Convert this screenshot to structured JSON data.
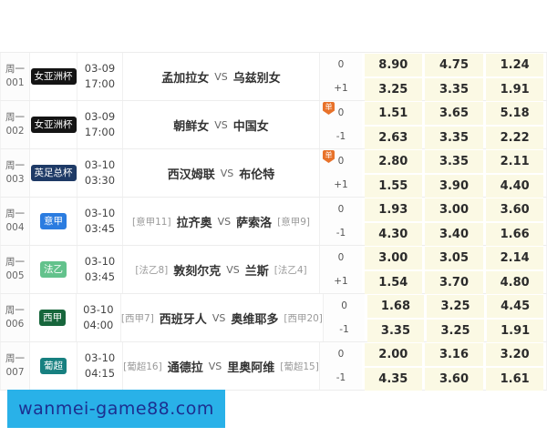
{
  "watermark": {
    "text": "wanmei-game88.com",
    "bg": "#29b1e8",
    "fg": "#1c2f90"
  },
  "icon": {
    "dan_label": "单",
    "color": "#e8722a"
  },
  "vs_label": "VS",
  "table": {
    "rows": [
      {
        "day": "周一",
        "num": "001",
        "league": "女亚洲杯",
        "league_color": "#141414",
        "date": "03-09",
        "time": "17:00",
        "home_tag": "",
        "home": "孟加拉女",
        "away": "乌兹别女",
        "away_tag": "",
        "has_icon": false,
        "lines": [
          {
            "handicap": "0",
            "odds": [
              "8.90",
              "4.75",
              "1.24"
            ]
          },
          {
            "handicap": "+1",
            "odds": [
              "3.25",
              "3.35",
              "1.91"
            ]
          }
        ]
      },
      {
        "day": "周一",
        "num": "002",
        "league": "女亚洲杯",
        "league_color": "#141414",
        "date": "03-09",
        "time": "17:00",
        "home_tag": "",
        "home": "朝鲜女",
        "away": "中国女",
        "away_tag": "",
        "has_icon": true,
        "lines": [
          {
            "handicap": "0",
            "odds": [
              "1.51",
              "3.65",
              "5.18"
            ]
          },
          {
            "handicap": "-1",
            "odds": [
              "2.63",
              "3.35",
              "2.22"
            ]
          }
        ]
      },
      {
        "day": "周一",
        "num": "003",
        "league": "英足总杯",
        "league_color": "#1e3a66",
        "date": "03-10",
        "time": "03:30",
        "home_tag": "",
        "home": "西汉姆联",
        "away": "布伦特",
        "away_tag": "",
        "has_icon": true,
        "lines": [
          {
            "handicap": "0",
            "odds": [
              "2.80",
              "3.35",
              "2.11"
            ]
          },
          {
            "handicap": "+1",
            "odds": [
              "1.55",
              "3.90",
              "4.40"
            ]
          }
        ]
      },
      {
        "day": "周一",
        "num": "004",
        "league": "意甲",
        "league_color": "#2b7ce0",
        "date": "03-10",
        "time": "03:45",
        "home_tag": "[意甲11]",
        "home": "拉齐奥",
        "away": "萨索洛",
        "away_tag": "[意甲9]",
        "has_icon": false,
        "lines": [
          {
            "handicap": "0",
            "odds": [
              "1.93",
              "3.00",
              "3.60"
            ]
          },
          {
            "handicap": "-1",
            "odds": [
              "4.30",
              "3.40",
              "1.66"
            ]
          }
        ]
      },
      {
        "day": "周一",
        "num": "005",
        "league": "法乙",
        "league_color": "#63c28c",
        "date": "03-10",
        "time": "03:45",
        "home_tag": "[法乙8]",
        "home": "敦刻尔克",
        "away": "兰斯",
        "away_tag": "[法乙4]",
        "has_icon": false,
        "lines": [
          {
            "handicap": "0",
            "odds": [
              "3.00",
              "3.05",
              "2.14"
            ]
          },
          {
            "handicap": "+1",
            "odds": [
              "1.54",
              "3.70",
              "4.80"
            ]
          }
        ]
      },
      {
        "day": "周一",
        "num": "006",
        "league": "西甲",
        "league_color": "#17663c",
        "date": "03-10",
        "time": "04:00",
        "home_tag": "[西甲7]",
        "home": "西班牙人",
        "away": "奥维耶多",
        "away_tag": "[西甲20]",
        "has_icon": false,
        "lines": [
          {
            "handicap": "0",
            "odds": [
              "1.68",
              "3.25",
              "4.45"
            ]
          },
          {
            "handicap": "-1",
            "odds": [
              "3.35",
              "3.25",
              "1.91"
            ]
          }
        ]
      },
      {
        "day": "周一",
        "num": "007",
        "league": "葡超",
        "league_color": "#178080",
        "date": "03-10",
        "time": "04:15",
        "home_tag": "[葡超16]",
        "home": "通德拉",
        "away": "里奥阿维",
        "away_tag": "[葡超15]",
        "has_icon": false,
        "lines": [
          {
            "handicap": "0",
            "odds": [
              "2.00",
              "3.16",
              "3.20"
            ]
          },
          {
            "handicap": "-1",
            "odds": [
              "4.35",
              "3.60",
              "1.61"
            ]
          }
        ]
      }
    ]
  }
}
